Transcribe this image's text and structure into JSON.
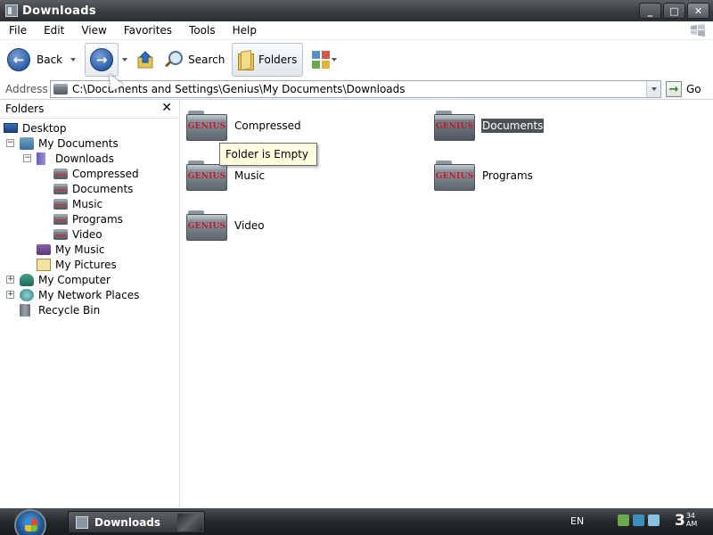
{
  "window": {
    "title": "Downloads",
    "buttons": {
      "minimize": "_",
      "maximize": "□",
      "close": "✕"
    }
  },
  "menubar": {
    "items": [
      "File",
      "Edit",
      "View",
      "Favorites",
      "Tools",
      "Help"
    ]
  },
  "toolbar": {
    "back_label": "Back",
    "search_label": "Search",
    "folders_label": "Folders"
  },
  "address": {
    "label": "Address",
    "path": "C:\\Documents and Settings\\Genius\\My Documents\\Downloads",
    "go_label": "Go"
  },
  "folders_pane": {
    "title": "Folders",
    "tree": [
      {
        "label": "Desktop",
        "icon": "desktop-icon",
        "level": 0,
        "expander": ""
      },
      {
        "label": "My Documents",
        "icon": "my-documents-icon",
        "level": 1,
        "expander": "−"
      },
      {
        "label": "Downloads",
        "icon": "downloads-icon",
        "level": 2,
        "expander": "−"
      },
      {
        "label": "Compressed",
        "icon": "folder-icon",
        "level": 3,
        "expander": ""
      },
      {
        "label": "Documents",
        "icon": "folder-icon",
        "level": 3,
        "expander": ""
      },
      {
        "label": "Music",
        "icon": "folder-icon",
        "level": 3,
        "expander": ""
      },
      {
        "label": "Programs",
        "icon": "folder-icon",
        "level": 3,
        "expander": ""
      },
      {
        "label": "Video",
        "icon": "folder-icon",
        "level": 3,
        "expander": ""
      },
      {
        "label": "My Music",
        "icon": "my-music-icon",
        "level": 2,
        "expander": ""
      },
      {
        "label": "My Pictures",
        "icon": "my-pictures-icon",
        "level": 2,
        "expander": ""
      },
      {
        "label": "My Computer",
        "icon": "my-computer-icon",
        "level": 1,
        "expander": "+"
      },
      {
        "label": "My Network Places",
        "icon": "network-places-icon",
        "level": 1,
        "expander": "+"
      },
      {
        "label": "Recycle Bin",
        "icon": "recycle-bin-icon",
        "level": 1,
        "expander": ""
      }
    ]
  },
  "main": {
    "folder_logo_text": "GENIUS",
    "items": [
      {
        "name": "Compressed",
        "selected": false
      },
      {
        "name": "Documents",
        "selected": true
      },
      {
        "name": "Music",
        "selected": false
      },
      {
        "name": "Programs",
        "selected": false
      },
      {
        "name": "Video",
        "selected": false
      }
    ],
    "tooltip": "Folder is Empty"
  },
  "taskbar": {
    "task_label": "Downloads",
    "language": "EN",
    "clock_hour": "3",
    "clock_minute": "34",
    "clock_ampm": "AM"
  },
  "colors": {
    "selection": "#4d5257",
    "tooltip_bg": "#ffffe1",
    "logo_red": "#c0192e"
  }
}
